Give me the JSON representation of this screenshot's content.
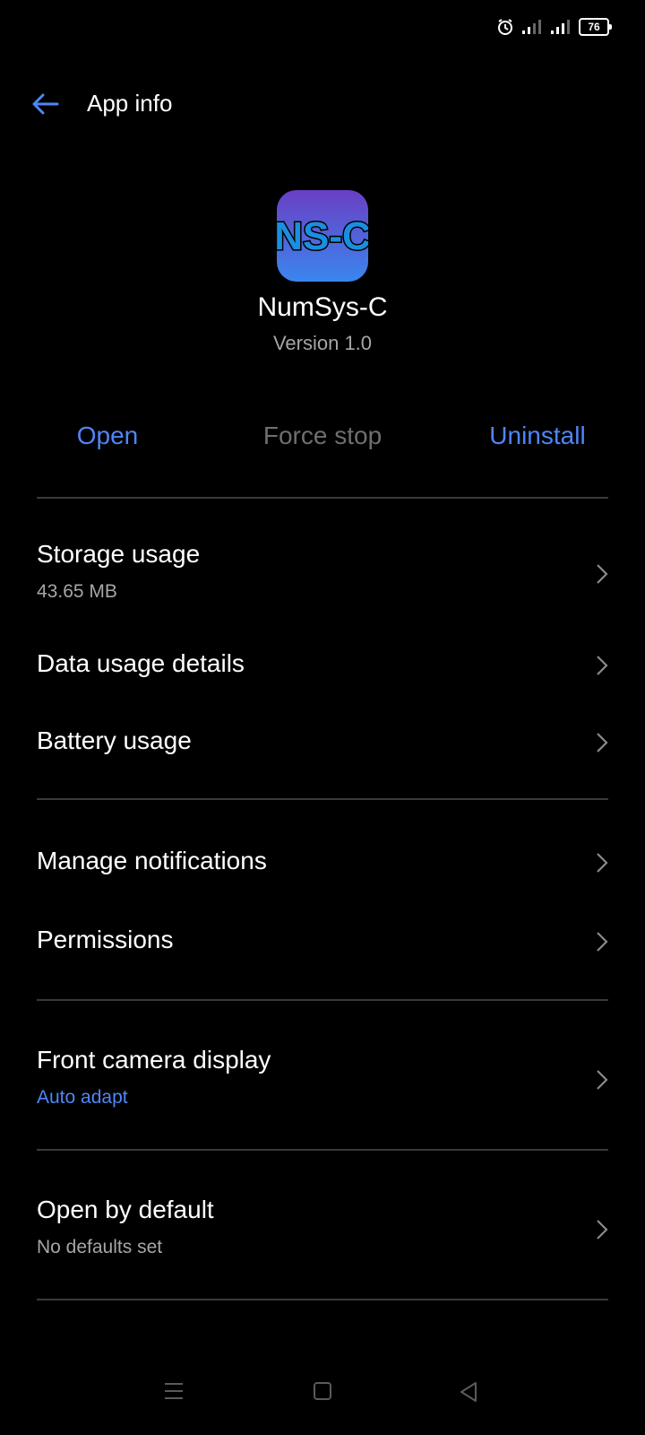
{
  "status_bar": {
    "battery": "76"
  },
  "header": {
    "title": "App info"
  },
  "app": {
    "icon_text": "NS-C",
    "name": "NumSys-C",
    "version": "Version 1.0"
  },
  "actions": {
    "open": "Open",
    "force_stop": "Force stop",
    "uninstall": "Uninstall"
  },
  "rows": {
    "storage": {
      "title": "Storage usage",
      "subtitle": "43.65 MB"
    },
    "data_usage": {
      "title": "Data usage details"
    },
    "battery": {
      "title": "Battery usage"
    },
    "notifications": {
      "title": "Manage notifications"
    },
    "permissions": {
      "title": "Permissions"
    },
    "front_camera": {
      "title": "Front camera display",
      "subtitle": "Auto adapt"
    },
    "open_default": {
      "title": "Open by default",
      "subtitle": "No defaults set"
    }
  },
  "colors": {
    "accent": "#4f86f7",
    "background": "#000000",
    "muted": "#a6a6a6",
    "disabled": "#6f6f6f"
  }
}
